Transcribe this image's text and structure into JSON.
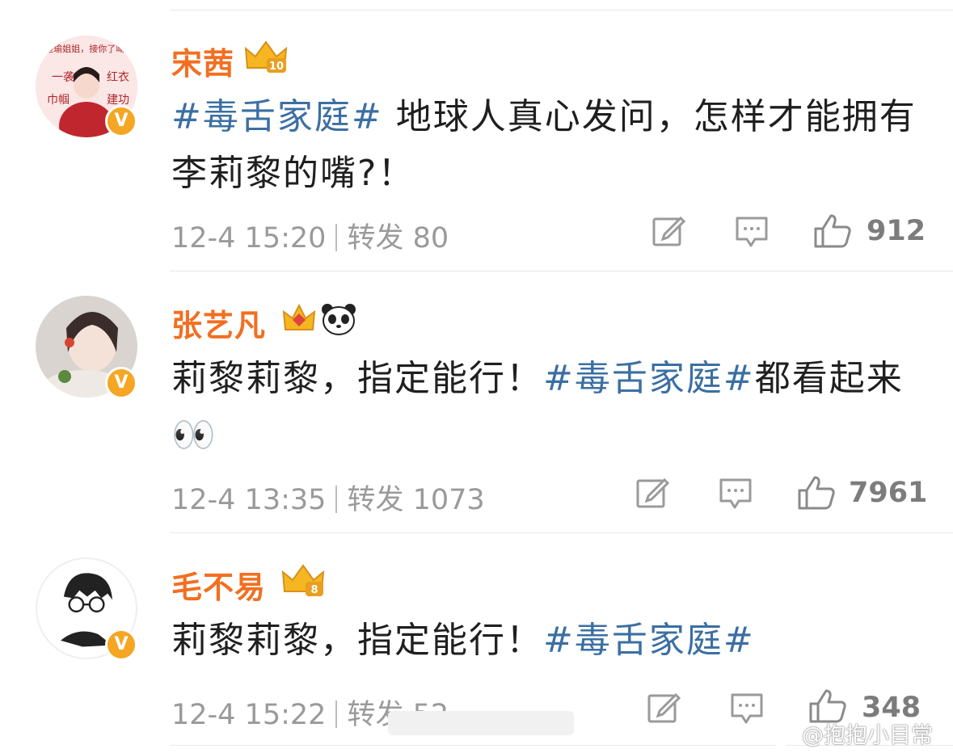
{
  "comments": [
    {
      "username": "宋茜",
      "crown_level": "10",
      "text_tag": "#毒舌家庭#",
      "text_before": "",
      "text_after": " 地球人真心发问，怎样才能拥有李莉黎的嘴?！",
      "time": "12-4 15:20",
      "repost_label": "转发",
      "repost_count": "80",
      "likes": "912",
      "avatar_texts": [
        "楚瑜姐姐，接你了呦!",
        "一袭红衣",
        "巾帼建功"
      ]
    },
    {
      "username": "张艺凡",
      "crown_level": "",
      "extra_badge": "panda",
      "text_before": "莉黎莉黎，指定能行！",
      "text_tag": "#毒舌家庭#",
      "text_after": "都看起来👀",
      "time": "12-4 13:35",
      "repost_label": "转发",
      "repost_count": "1073",
      "likes": "7961"
    },
    {
      "username": "毛不易",
      "crown_level": "8",
      "text_before": "莉黎莉黎，指定能行！",
      "text_tag": "#毒舌家庭#",
      "text_after": "",
      "time": "12-4 15:22",
      "repost_label": "转发",
      "repost_count": "52",
      "likes": "348"
    }
  ],
  "verified_badge": "V",
  "watermark": "@抱抱小目常",
  "colors": {
    "username": "#f26f21",
    "hashtag": "#3b6fa3",
    "meta": "#9a9a9a",
    "badge": "#f5a623"
  },
  "icons": [
    "edit-icon",
    "comment-icon",
    "thumbs-up-icon",
    "crown-icon",
    "panda-icon",
    "weibo-logo-icon"
  ]
}
